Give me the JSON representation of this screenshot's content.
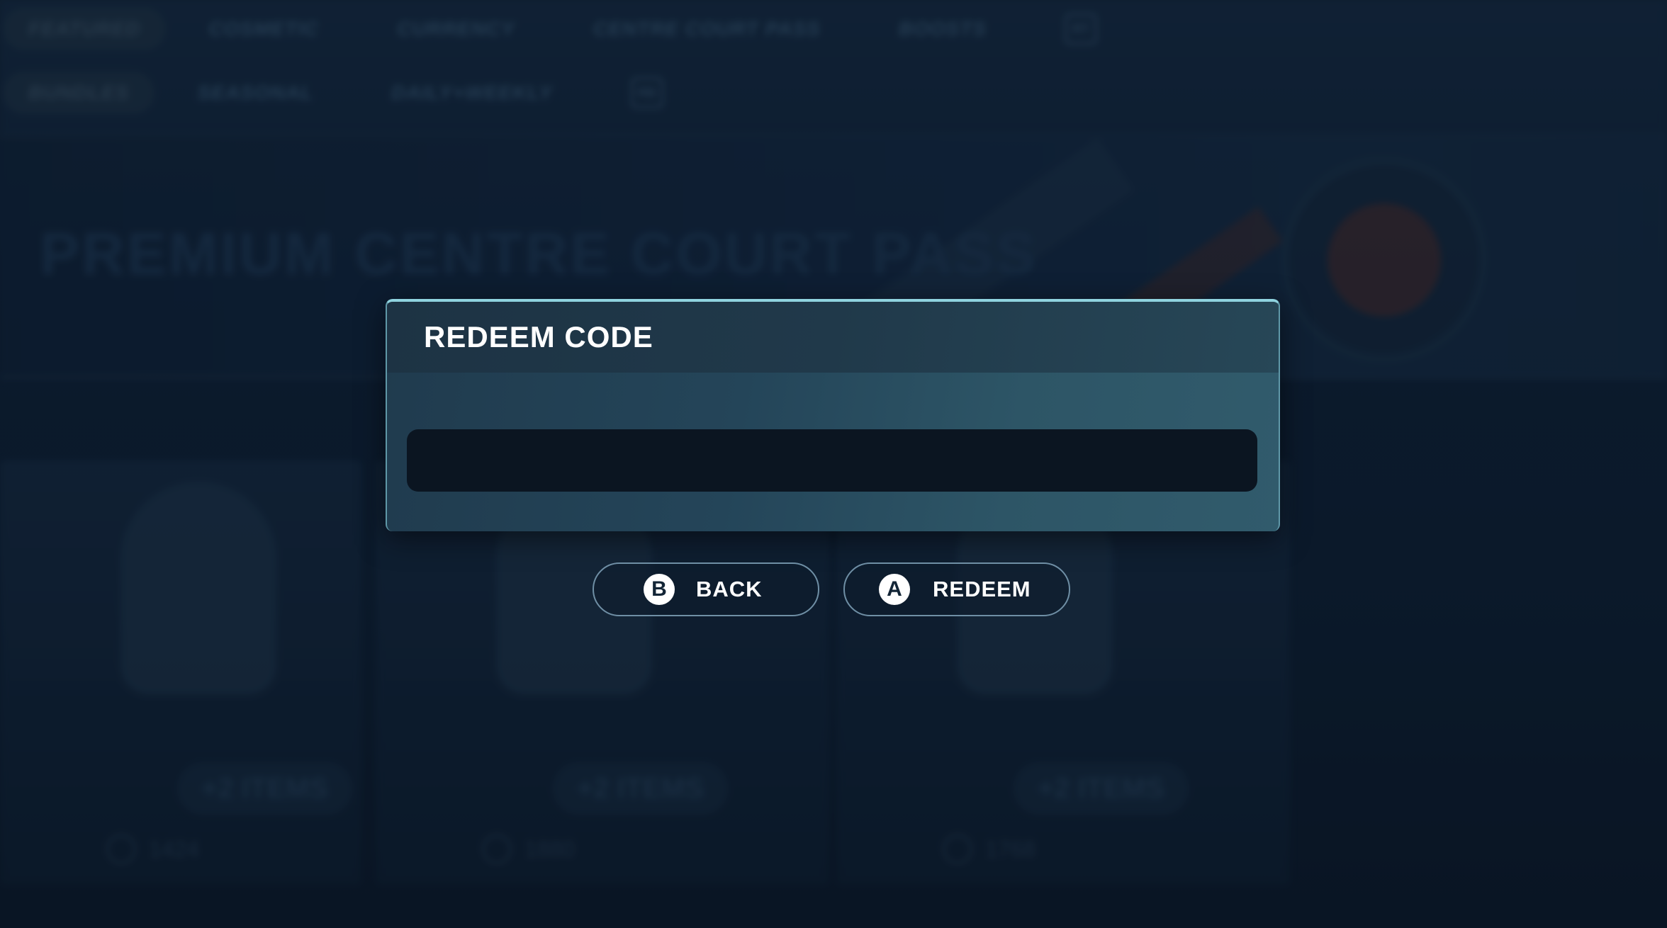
{
  "store": {
    "primary_tabs": [
      {
        "label": "FEATURED",
        "active": true
      },
      {
        "label": "COSMETIC",
        "active": false
      },
      {
        "label": "CURRENCY",
        "active": false
      },
      {
        "label": "CENTRE COURT PASS",
        "active": false
      },
      {
        "label": "BOOSTS",
        "active": false
      }
    ],
    "primary_shoulder_button": "RT",
    "secondary_tabs": [
      {
        "label": "BUNDLES",
        "active": true
      },
      {
        "label": "SEASONAL",
        "active": false
      },
      {
        "label": "DAILY+WEEKLY",
        "active": false
      }
    ],
    "secondary_shoulder_button": "RB",
    "banner_title": "PREMIUM CENTRE COURT PASS",
    "cards": [
      {
        "items_label": "+2 ITEMS",
        "price": "1424"
      },
      {
        "items_label": "+2 ITEMS",
        "price": "1880"
      },
      {
        "items_label": "+2 ITEMS",
        "price": "1768"
      }
    ]
  },
  "dialog": {
    "title": "REDEEM CODE",
    "code_value": "",
    "back_button": {
      "glyph": "B",
      "label": "BACK"
    },
    "redeem_button": {
      "glyph": "A",
      "label": "REDEEM"
    }
  },
  "colors": {
    "modal_accent": "#8fd3df",
    "input_background": "#0b1521",
    "button_border": "#6f8fa5"
  }
}
